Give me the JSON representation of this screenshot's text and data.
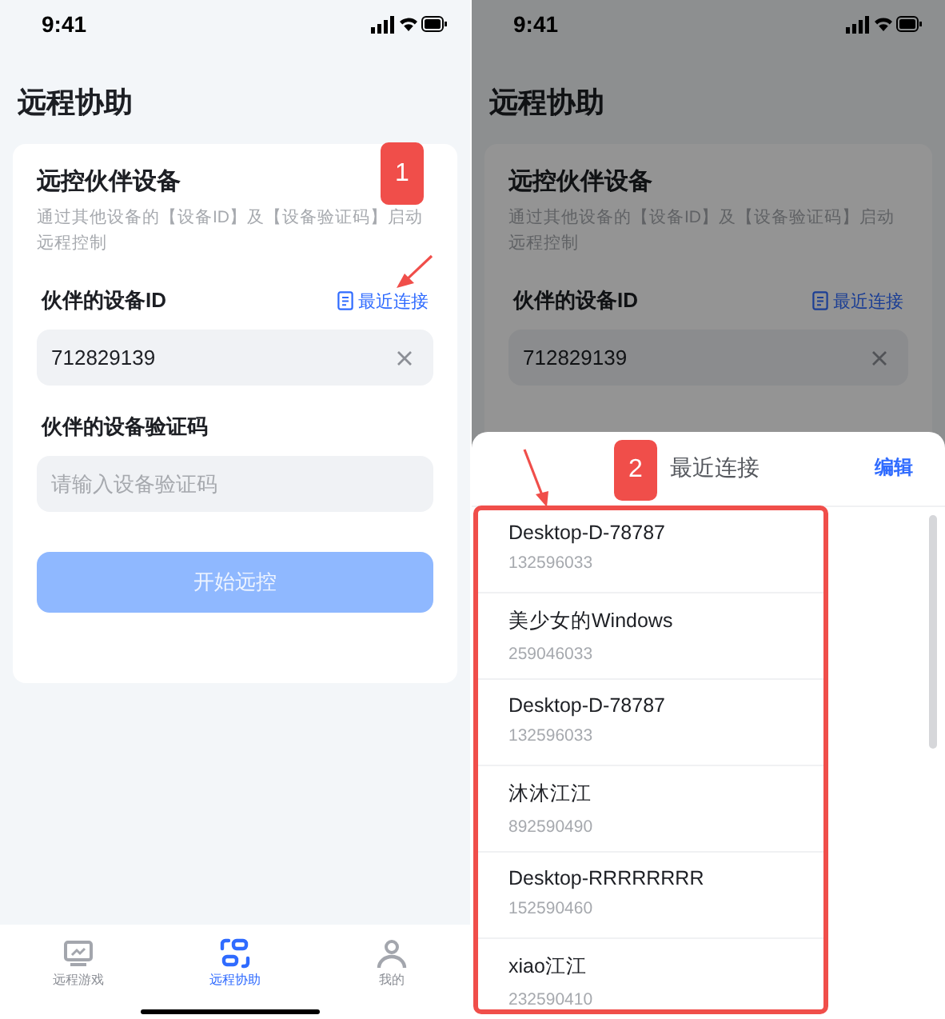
{
  "screens": [
    {
      "status_time": "9:41",
      "page_title": "远程协助",
      "card": {
        "title": "远控伙伴设备",
        "description": "通过其他设备的【设备ID】及【设备验证码】启动远程控制",
        "id_label": "伙伴的设备ID",
        "recent_link": "最近连接",
        "id_value": "712829139",
        "code_label": "伙伴的设备验证码",
        "code_placeholder": "请输入设备验证码",
        "start_button": "开始远控",
        "start_disabled": true
      },
      "tabs": [
        {
          "kind": "game",
          "label": "远程游戏",
          "selected": false
        },
        {
          "kind": "assist",
          "label": "远程协助",
          "selected": true
        },
        {
          "kind": "me",
          "label": "我的",
          "selected": false
        }
      ],
      "annotation": "1"
    },
    {
      "status_time": "9:41",
      "page_title": "远程协助",
      "card": {
        "title": "远控伙伴设备",
        "description": "通过其他设备的【设备ID】及【设备验证码】启动远程控制",
        "id_label": "伙伴的设备ID",
        "recent_link": "最近连接",
        "id_value": "712829139"
      },
      "sheet": {
        "title": "最近连接",
        "edit": "编辑",
        "items": [
          {
            "name": "Desktop-D-78787",
            "id": "132596033"
          },
          {
            "name": "美少女的Windows",
            "id": "259046033"
          },
          {
            "name": "Desktop-D-78787",
            "id": "132596033"
          },
          {
            "name": "沐沐江江",
            "id": "892590490"
          },
          {
            "name": "Desktop-RRRRRRRR",
            "id": "152590460"
          },
          {
            "name": "xiao江江",
            "id": "232590410"
          }
        ]
      },
      "annotation": "2"
    }
  ]
}
